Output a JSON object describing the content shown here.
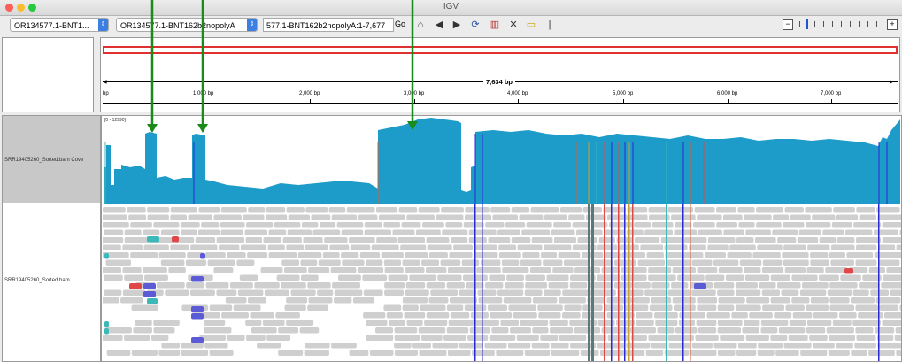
{
  "window": {
    "title": "IGV"
  },
  "toolbar": {
    "genome": "OR134577.1-BNT1...",
    "chromosome": "OR134577.1-BNT162b2nopolyA",
    "locus": "577.1-BNT162b2nopolyA:1-7,677",
    "go_label": "Go"
  },
  "ruler": {
    "range_label": "7,634 bp",
    "ticks": [
      "bp",
      "1,000 bp",
      "2,000 bp",
      "3,000 bp",
      "4,000 bp",
      "5,000 bp",
      "6,000 bp",
      "7,000 bp"
    ]
  },
  "tracks": {
    "coverage_name": "SRR19405260_Sorted.bam Cove",
    "coverage_scale": "[0 - 12990]",
    "alignment_name": "SRR19405260_Sorted.bam"
  },
  "colors": {
    "coverage": "#1d9bc9",
    "read": "#cfcfcf",
    "insertion": "#5b5bd6",
    "mismatch_red": "#e04848",
    "mismatch_teal": "#3cb8b8",
    "annotation_arrow": "#1a8a1a",
    "region_box": "#e03030"
  }
}
